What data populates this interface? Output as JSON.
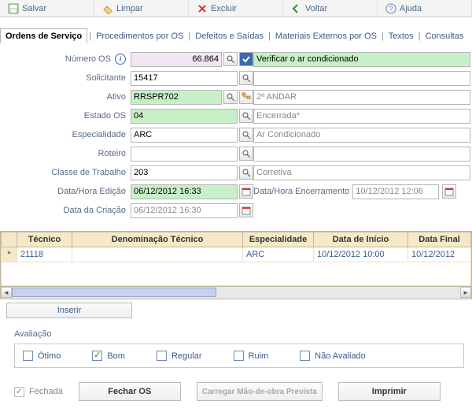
{
  "toolbar": {
    "save": "Salvar",
    "clear": "Limpar",
    "delete": "Excluir",
    "back": "Voltar",
    "help": "Ajuda"
  },
  "tabs": {
    "active": "Ordens de Serviço",
    "t1": "Procedimentos por OS",
    "t2": "Defeitos e Saídas",
    "t3": "Materiais Externos por OS",
    "t4": "Textos",
    "t5": "Consultas"
  },
  "labels": {
    "numero_os": "Número OS",
    "solicitante": "Solicitante",
    "ativo": "Ativo",
    "estado_os": "Estado OS",
    "especialidade": "Especialidade",
    "roteiro": "Roteiro",
    "classe": "Classe de Trabalho",
    "data_edicao": "Data/Hora Edição",
    "data_criacao": "Data da Criação",
    "data_encerr": "Data/Hora Encerramento"
  },
  "values": {
    "numero_os": "66.864",
    "numero_os_desc": "Verificar o ar condicionado",
    "solicitante": "15417",
    "solicitante_desc": "",
    "ativo": "RRSPR702",
    "ativo_desc": "2º ANDAR",
    "estado_os": "04",
    "estado_os_desc": "Encerrada*",
    "especialidade": "ARC",
    "especialidade_desc": "Ar Condicionado",
    "roteiro": "",
    "roteiro_desc": "",
    "classe": "203",
    "classe_desc": "Corretiva",
    "data_edicao": "06/12/2012 16:33",
    "data_criacao": "06/12/2012 16:30",
    "data_encerr": "10/12/2012 12:06"
  },
  "grid": {
    "headers": {
      "tecnico": "Técnico",
      "denom": "Denominação Técnico",
      "esp": "Especialidade",
      "inicio": "Data de Início",
      "final": "Data Final"
    },
    "row": {
      "tecnico": "21118",
      "denom": "",
      "esp": "ARC",
      "inicio": "10/12/2012 10:00",
      "final": "10/12/2012"
    },
    "inserir": "Inserir"
  },
  "aval": {
    "title": "Avaliação",
    "otimo": "Ótimo",
    "bom": "Bom",
    "regular": "Regular",
    "ruim": "Ruim",
    "nao": "Não Avaliado"
  },
  "bottom": {
    "fechada": "Fechada",
    "fechar_os": "Fechar OS",
    "carregar": "Carregar Mão-de-obra Prevista",
    "imprimir": "Imprimir"
  }
}
